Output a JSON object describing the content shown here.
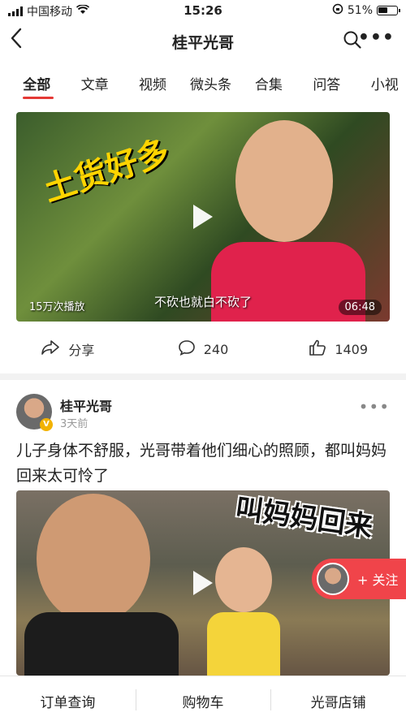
{
  "status_bar": {
    "carrier": "中国移动",
    "time": "15:26",
    "battery": "51%"
  },
  "nav": {
    "title": "桂平光哥"
  },
  "tabs": [
    {
      "label": "全部",
      "active": true
    },
    {
      "label": "文章"
    },
    {
      "label": "视频"
    },
    {
      "label": "微头条"
    },
    {
      "label": "合集"
    },
    {
      "label": "问答"
    },
    {
      "label": "小视"
    }
  ],
  "video1": {
    "overlay_title": "土货好多",
    "subtitle": "不砍也就白不砍了",
    "views": "15万次播放",
    "duration": "06:48"
  },
  "actions": {
    "share": "分享",
    "comments": "240",
    "likes": "1409"
  },
  "post": {
    "author": "桂平光哥",
    "time": "3天前",
    "text": "儿子身体不舒服，光哥带着他们细心的照顾，都叫妈妈回来太可怜了",
    "video_overlay": "叫妈妈回来"
  },
  "follow_button": {
    "label": "+ 关注"
  },
  "bottom_bar": [
    "订单查询",
    "购物车",
    "光哥店铺"
  ],
  "colors": {
    "accent": "#e53935",
    "follow_bg": "#f0444a"
  }
}
